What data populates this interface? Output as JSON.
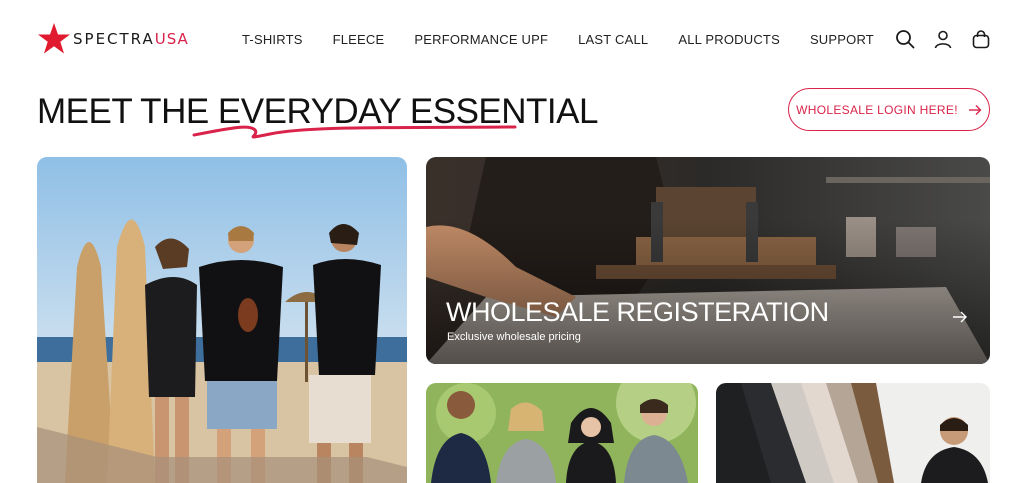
{
  "brand": {
    "name_main": "SPECTRA",
    "name_accent": "USA",
    "accent_color": "#d9234a"
  },
  "nav": {
    "items": [
      {
        "label": "T-SHIRTS"
      },
      {
        "label": "FLEECE"
      },
      {
        "label": "PERFORMANCE UPF"
      },
      {
        "label": "LAST CALL"
      },
      {
        "label": "ALL PRODUCTS"
      },
      {
        "label": "SUPPORT"
      }
    ]
  },
  "header_icons": [
    "search-icon",
    "account-icon",
    "cart-icon"
  ],
  "hero": {
    "headline": "MEET THE EVERYDAY ESSENTIAL",
    "login_button": "WHOLESALE LOGIN HERE!"
  },
  "cards": {
    "wholesale": {
      "title": "WHOLESALE REGISTERATION",
      "subtitle": "Exclusive wholesale pricing"
    }
  }
}
